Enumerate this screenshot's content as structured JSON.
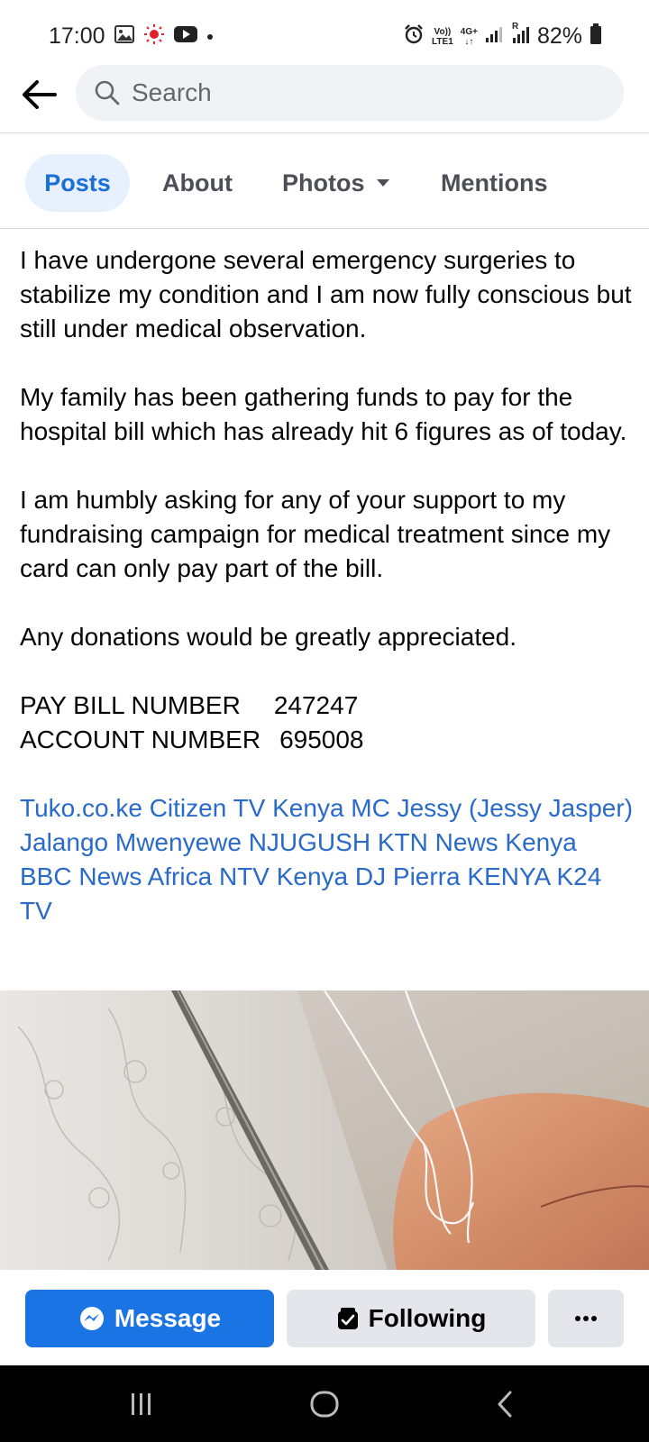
{
  "status_bar": {
    "time": "17:00",
    "volte_label": "Vo))",
    "lte_label": "LTE1",
    "network_label": "4G+",
    "roaming_label": "R",
    "battery_percent": "82%"
  },
  "header": {
    "search_placeholder": "Search"
  },
  "tabs": [
    {
      "label": "Posts",
      "active": true
    },
    {
      "label": "About",
      "active": false
    },
    {
      "label": "Photos",
      "active": false
    },
    {
      "label": "Mentions",
      "active": false
    }
  ],
  "post": {
    "paragraphs": [
      "I have undergone several emergency surgeries to stabilize my condition and I am now fully conscious but still under medical observation.",
      "My family has been gathering funds to pay for the hospital bill which has already hit 6 figures as of today.",
      "I am humbly asking for any of your support to my fundraising campaign for medical treatment since my card can only pay part of the bill.",
      "Any donations would be greatly appreciated."
    ],
    "pay_bill_label": "PAY BILL NUMBER",
    "pay_bill_value": "247247",
    "account_label": "ACCOUNT NUMBER",
    "account_value": "695008",
    "tags": [
      "Tuko.co.ke",
      "Citizen TV Kenya",
      "MC Jessy (Jessy Jasper)",
      "Jalango",
      "Mwenyewe NJUGUSH",
      "KTN News Kenya",
      "BBC News Africa",
      "NTV Kenya",
      "DJ Pierra",
      "KENYA K24 TV"
    ]
  },
  "actions": {
    "message_label": "Message",
    "following_label": "Following"
  },
  "colors": {
    "accent": "#1b74e4",
    "link": "#2a6ac8",
    "tab_active_bg": "#e7f0fd",
    "button_gray": "#e4e6eb"
  },
  "icons": [
    "gallery-icon",
    "sun-icon",
    "youtube-icon",
    "alarm-icon",
    "signal-icon",
    "battery-icon",
    "back-arrow-icon",
    "search-icon",
    "caret-down-icon",
    "messenger-icon",
    "following-icon",
    "more-icon",
    "recents-icon",
    "home-icon",
    "back-nav-icon"
  ]
}
